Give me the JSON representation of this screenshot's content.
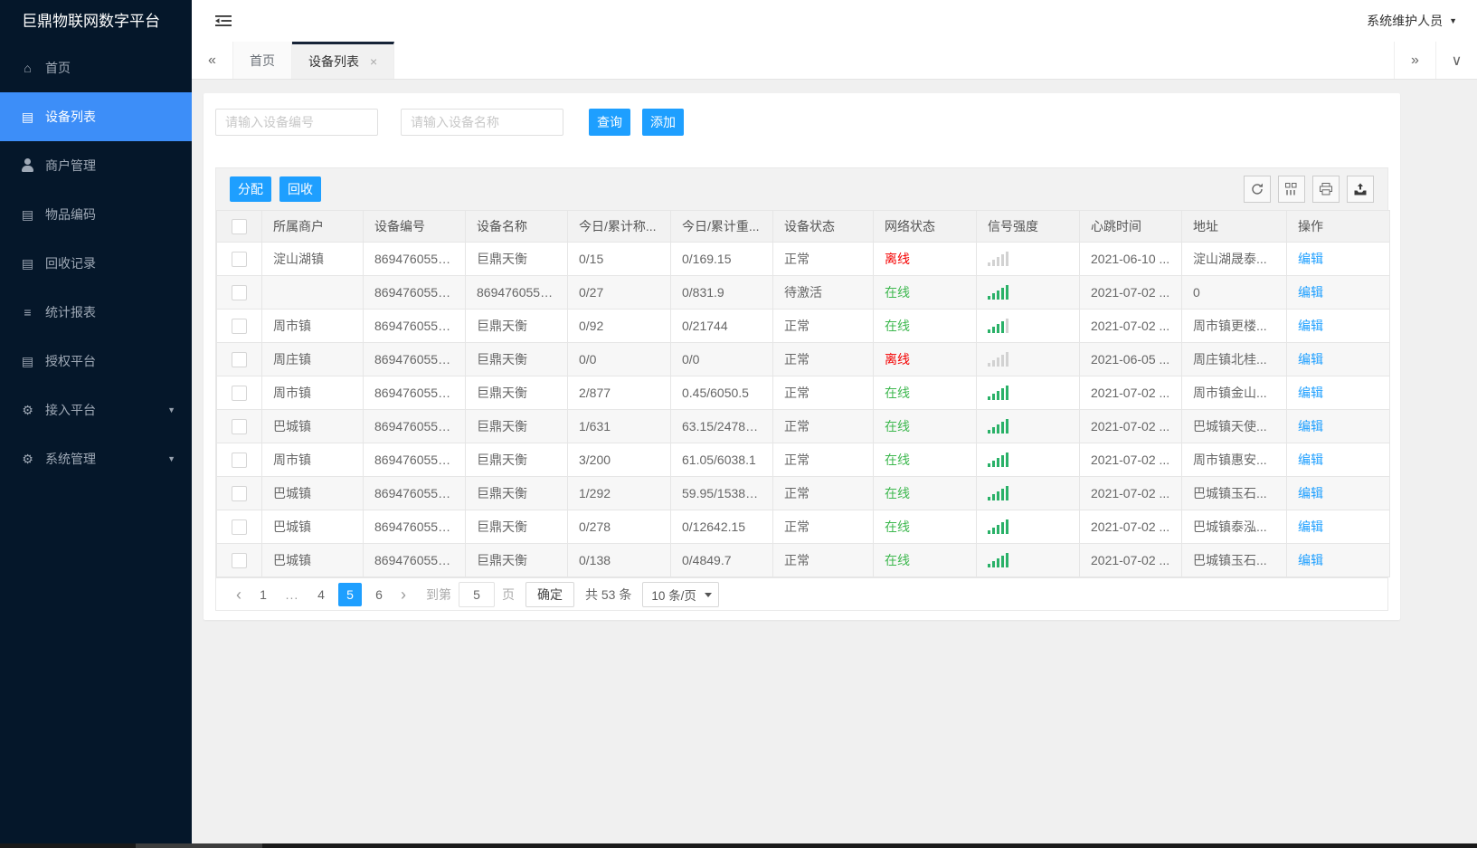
{
  "colors": {
    "accent_blue": "#1e9fff",
    "sidebar_active_blue": "#3d8ef8",
    "online_green": "#3eb84f",
    "offline_red": "#f40000",
    "signal_on_green": "#2ab168",
    "signal_off_gray": "#d2d2d2"
  },
  "icons": {
    "caret_down": "▼",
    "collapse_tabs": "«",
    "expand_tabs": "»",
    "tab_menu": "∨",
    "close": "×",
    "prev": "‹",
    "next": "›"
  },
  "sidebar": {
    "title": "巨鼎物联网数字平台",
    "items": [
      {
        "label": "首页",
        "icon": "home-icon",
        "glyph": "⌂",
        "state": "",
        "expandable": false
      },
      {
        "label": "设备列表",
        "icon": "device-list-icon",
        "glyph": "▤",
        "state": "active",
        "expandable": false
      },
      {
        "label": "商户管理",
        "icon": "merchant-icon",
        "glyph": "person",
        "state": "",
        "expandable": false
      },
      {
        "label": "物品编码",
        "icon": "item-code-icon",
        "glyph": "▤",
        "state": "",
        "expandable": false
      },
      {
        "label": "回收记录",
        "icon": "recycle-record-icon",
        "glyph": "▤",
        "state": "",
        "expandable": false
      },
      {
        "label": "统计报表",
        "icon": "report-icon",
        "glyph": "≡",
        "state": "",
        "expandable": false
      },
      {
        "label": "授权平台",
        "icon": "authorize-platform-icon",
        "glyph": "▤",
        "state": "",
        "expandable": false
      },
      {
        "label": "接入平台",
        "icon": "access-platform-icon",
        "glyph": "⚙",
        "state": "",
        "expandable": true
      },
      {
        "label": "系统管理",
        "icon": "system-manage-icon",
        "glyph": "⚙",
        "state": "",
        "expandable": true
      }
    ]
  },
  "topbar": {
    "user": "系统维护人员"
  },
  "tabbar": {
    "tabs": [
      {
        "label": "首页",
        "state": "",
        "closable": false
      },
      {
        "label": "设备列表",
        "state": "active",
        "closable": true
      }
    ]
  },
  "search": {
    "device_no_placeholder": "请输入设备编号",
    "device_name_placeholder": "请输入设备名称",
    "query_label": "查询",
    "add_label": "添加"
  },
  "toolbar": {
    "assign_label": "分配",
    "recycle_label": "回收"
  },
  "table": {
    "columns": [
      "所属商户",
      "设备编号",
      "设备名称",
      "今日/累计称...",
      "今日/累计重...",
      "设备状态",
      "网络状态",
      "信号强度",
      "心跳时间",
      "地址",
      "操作"
    ],
    "edit_label": "编辑",
    "rows": [
      {
        "merchant": "淀山湖镇",
        "device_no": "8694760552...",
        "device_name": "巨鼎天衡",
        "today_count": "0/15",
        "today_weight": "0/169.15",
        "device_status": "正常",
        "network_status": "离线",
        "net_state": "offline",
        "signal": 0,
        "heartbeat": "2021-06-10 ...",
        "address": "淀山湖晟泰..."
      },
      {
        "merchant": "",
        "device_no": "8694760552...",
        "device_name": "8694760552...",
        "today_count": "0/27",
        "today_weight": "0/831.9",
        "device_status": "待激活",
        "network_status": "在线",
        "net_state": "online",
        "signal": 5,
        "heartbeat": "2021-07-02 ...",
        "address": "0"
      },
      {
        "merchant": "周市镇",
        "device_no": "8694760552...",
        "device_name": "巨鼎天衡",
        "today_count": "0/92",
        "today_weight": "0/21744",
        "device_status": "正常",
        "network_status": "在线",
        "net_state": "online",
        "signal": 4,
        "heartbeat": "2021-07-02 ...",
        "address": "周市镇更楼..."
      },
      {
        "merchant": "周庄镇",
        "device_no": "8694760552...",
        "device_name": "巨鼎天衡",
        "today_count": "0/0",
        "today_weight": "0/0",
        "device_status": "正常",
        "network_status": "离线",
        "net_state": "offline",
        "signal": 0,
        "heartbeat": "2021-06-05 ...",
        "address": "周庄镇北桂..."
      },
      {
        "merchant": "周市镇",
        "device_no": "8694760552...",
        "device_name": "巨鼎天衡",
        "today_count": "2/877",
        "today_weight": "0.45/6050.5",
        "device_status": "正常",
        "network_status": "在线",
        "net_state": "online",
        "signal": 5,
        "heartbeat": "2021-07-02 ...",
        "address": "周市镇金山..."
      },
      {
        "merchant": "巴城镇",
        "device_no": "8694760552...",
        "device_name": "巨鼎天衡",
        "today_count": "1/631",
        "today_weight": "63.15/24785...",
        "device_status": "正常",
        "network_status": "在线",
        "net_state": "online",
        "signal": 5,
        "heartbeat": "2021-07-02 ...",
        "address": "巴城镇天使..."
      },
      {
        "merchant": "周市镇",
        "device_no": "8694760552...",
        "device_name": "巨鼎天衡",
        "today_count": "3/200",
        "today_weight": "61.05/6038.1",
        "device_status": "正常",
        "network_status": "在线",
        "net_state": "online",
        "signal": 5,
        "heartbeat": "2021-07-02 ...",
        "address": "周市镇惠安..."
      },
      {
        "merchant": "巴城镇",
        "device_no": "8694760551...",
        "device_name": "巨鼎天衡",
        "today_count": "1/292",
        "today_weight": "59.95/15382...",
        "device_status": "正常",
        "network_status": "在线",
        "net_state": "online",
        "signal": 5,
        "heartbeat": "2021-07-02 ...",
        "address": "巴城镇玉石..."
      },
      {
        "merchant": "巴城镇",
        "device_no": "8694760552...",
        "device_name": "巨鼎天衡",
        "today_count": "0/278",
        "today_weight": "0/12642.15",
        "device_status": "正常",
        "network_status": "在线",
        "net_state": "online",
        "signal": 5,
        "heartbeat": "2021-07-02 ...",
        "address": "巴城镇泰泓..."
      },
      {
        "merchant": "巴城镇",
        "device_no": "8694760551...",
        "device_name": "巨鼎天衡",
        "today_count": "0/138",
        "today_weight": "0/4849.7",
        "device_status": "正常",
        "network_status": "在线",
        "net_state": "online",
        "signal": 5,
        "heartbeat": "2021-07-02 ...",
        "address": "巴城镇玉石..."
      }
    ]
  },
  "pagination": {
    "pages": [
      {
        "label": "1",
        "state": ""
      },
      {
        "label": "...",
        "state": "ellipsis"
      },
      {
        "label": "4",
        "state": ""
      },
      {
        "label": "5",
        "state": "active"
      },
      {
        "label": "6",
        "state": ""
      }
    ],
    "goto_label": "到第",
    "goto_value": "5",
    "page_unit_label": "页",
    "confirm_label": "确定",
    "total_label": "共 53 条",
    "per_page": "10 条/页"
  }
}
